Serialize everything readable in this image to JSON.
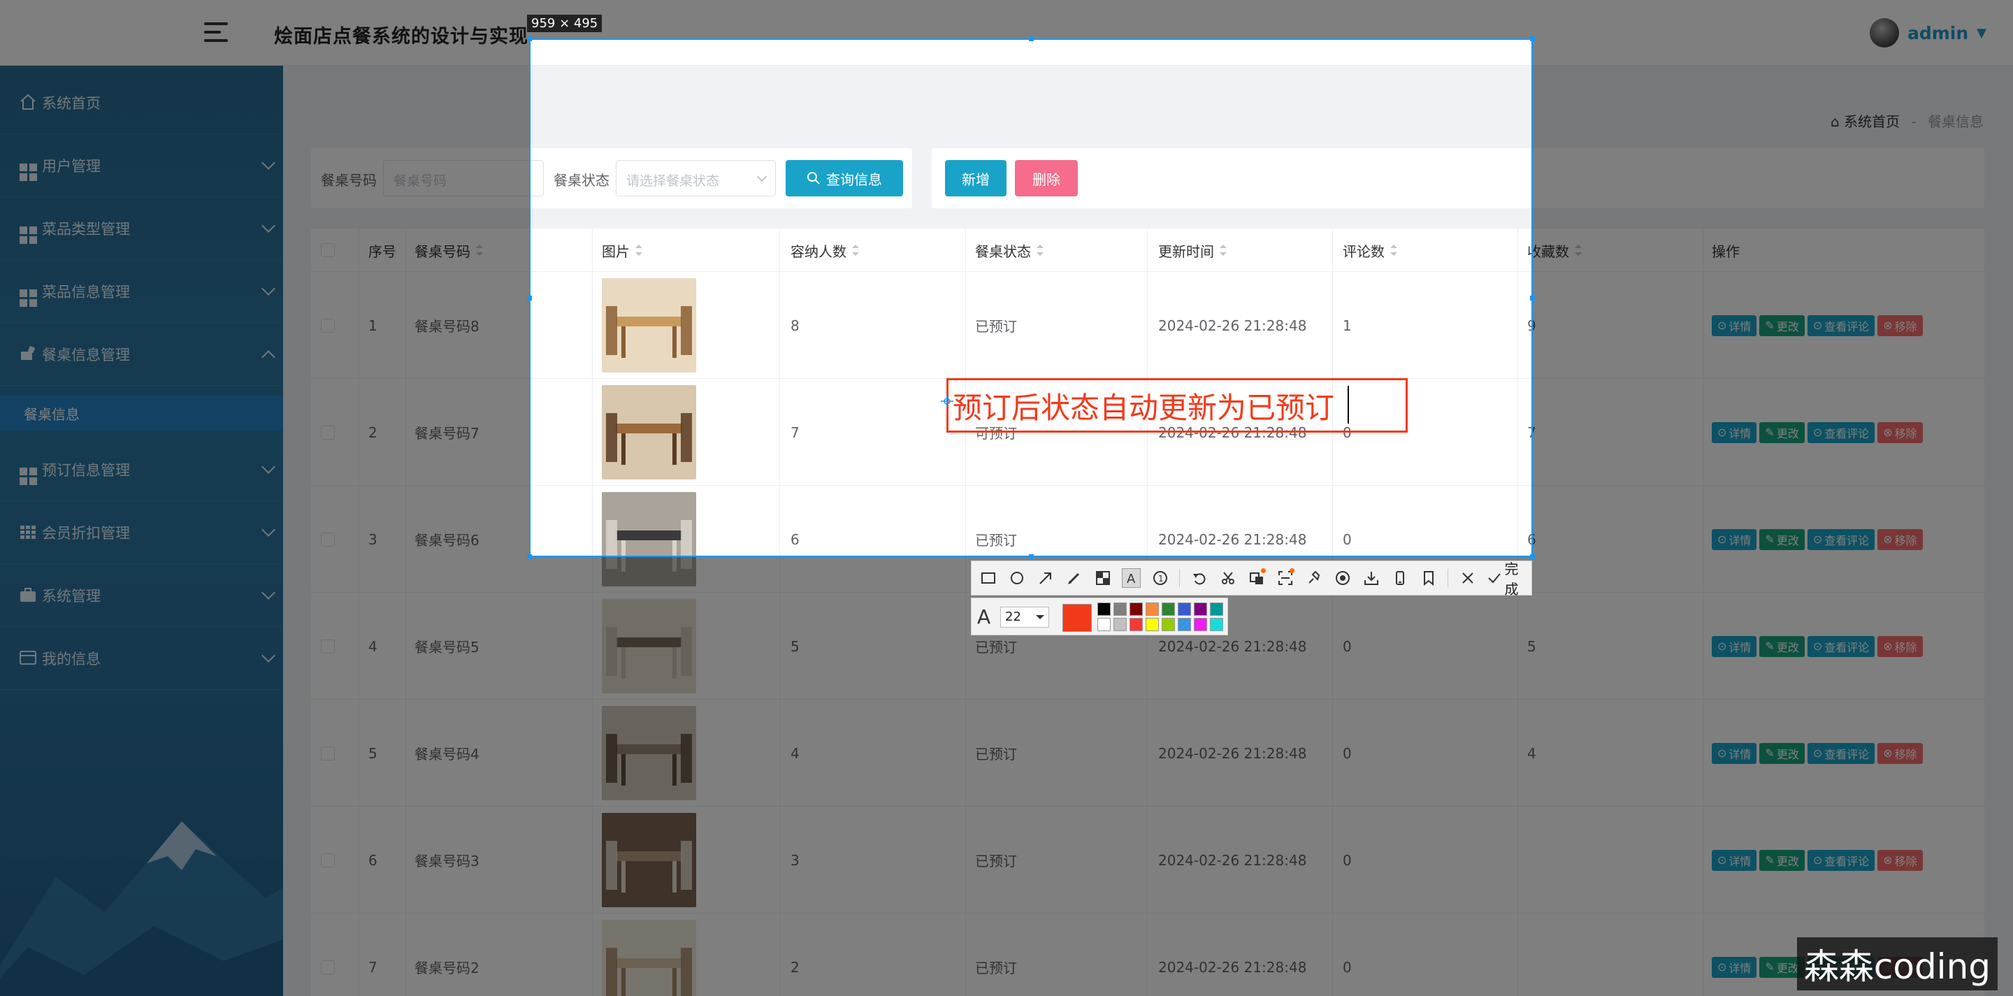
{
  "header": {
    "app_title": "烩面店点餐系统的设计与实现",
    "user_name": "admin",
    "user_caret": "▼"
  },
  "sidebar": {
    "items": [
      {
        "label": "系统首页",
        "icon": "home-icon"
      },
      {
        "label": "用户管理",
        "icon": "grid-icon"
      },
      {
        "label": "菜品类型管理",
        "icon": "grid-icon"
      },
      {
        "label": "菜品信息管理",
        "icon": "grid-icon"
      },
      {
        "label": "餐桌信息管理",
        "icon": "gavel-icon"
      },
      {
        "label": "预订信息管理",
        "icon": "grid-icon"
      },
      {
        "label": "会员折扣管理",
        "icon": "apps-icon"
      },
      {
        "label": "系统管理",
        "icon": "briefcase-icon"
      },
      {
        "label": "我的信息",
        "icon": "card-icon"
      }
    ],
    "sub_item": "餐桌信息"
  },
  "breadcrumb": {
    "home": "系统首页",
    "separator": "-",
    "current": "餐桌信息"
  },
  "search": {
    "code_label": "餐桌号码",
    "code_placeholder": "餐桌号码",
    "status_label": "餐桌状态",
    "status_placeholder": "请选择餐桌状态",
    "search_button": "查询信息"
  },
  "actions": {
    "add_button": "新增",
    "delete_button": "删除"
  },
  "table": {
    "headers": [
      "序号",
      "餐桌号码",
      "图片",
      "容纳人数",
      "餐桌状态",
      "更新时间",
      "评论数",
      "收藏数",
      "操作"
    ],
    "rows": [
      {
        "index": "1",
        "code": "餐桌号码8",
        "capacity": "8",
        "status": "已预订",
        "updated": "2024-02-26 21:28:48",
        "comments": "1",
        "favorites": "9"
      },
      {
        "index": "2",
        "code": "餐桌号码7",
        "capacity": "7",
        "status": "可预订",
        "updated": "2024-02-26 21:28:48",
        "comments": "0",
        "favorites": "7"
      },
      {
        "index": "3",
        "code": "餐桌号码6",
        "capacity": "6",
        "status": "已预订",
        "updated": "2024-02-26 21:28:48",
        "comments": "0",
        "favorites": "6"
      },
      {
        "index": "4",
        "code": "餐桌号码5",
        "capacity": "5",
        "status": "已预订",
        "updated": "2024-02-26 21:28:48",
        "comments": "0",
        "favorites": "5"
      },
      {
        "index": "5",
        "code": "餐桌号码4",
        "capacity": "4",
        "status": "已预订",
        "updated": "2024-02-26 21:28:48",
        "comments": "0",
        "favorites": "4"
      },
      {
        "index": "6",
        "code": "餐桌号码3",
        "capacity": "3",
        "status": "已预订",
        "updated": "2024-02-26 21:28:48",
        "comments": "0",
        "favorites": ""
      },
      {
        "index": "7",
        "code": "餐桌号码2",
        "capacity": "2",
        "status": "已预订",
        "updated": "2024-02-26 21:28:48",
        "comments": "0",
        "favorites": ""
      }
    ],
    "ops": {
      "detail": "详情",
      "edit": "更改",
      "view_comments": "查看评论",
      "remove": "移除"
    }
  },
  "capture_tool": {
    "size_label": "959 × 495",
    "annotation_text": "预订后状态自动更新为已预订",
    "font_size": "22",
    "done_label": "完成",
    "current_color": "#f23a1a",
    "palette": [
      "#000000",
      "#808080",
      "#800000",
      "#f7883a",
      "#308430",
      "#385ad3",
      "#800080",
      "#009999",
      "#ffffff",
      "#c0c0c0",
      "#fb3838",
      "#ffff00",
      "#99cc00",
      "#3894e4",
      "#f31bf3",
      "#16dcdc"
    ]
  },
  "watermark": "森森coding"
}
